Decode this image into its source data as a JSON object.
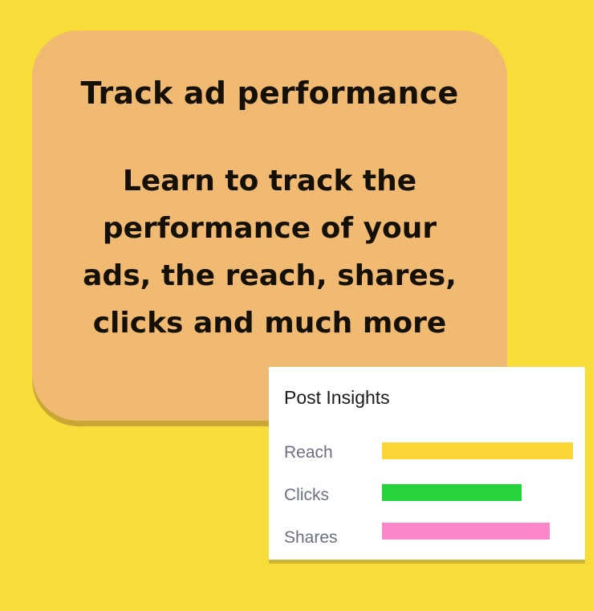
{
  "card": {
    "title": "Track ad performance",
    "body": "Learn to track the performance of your ads, the reach, shares, clicks and much more"
  },
  "insights": {
    "title": "Post Insights",
    "metrics": [
      {
        "label": "Reach",
        "value": 1.0,
        "color": "#FAD535"
      },
      {
        "label": "Clicks",
        "value": 0.73,
        "color": "#27D33B"
      },
      {
        "label": "Shares",
        "value": 0.88,
        "color": "#FC84C8"
      }
    ]
  },
  "colors": {
    "background": "#F8DC3A",
    "card": "#F0BA72"
  }
}
